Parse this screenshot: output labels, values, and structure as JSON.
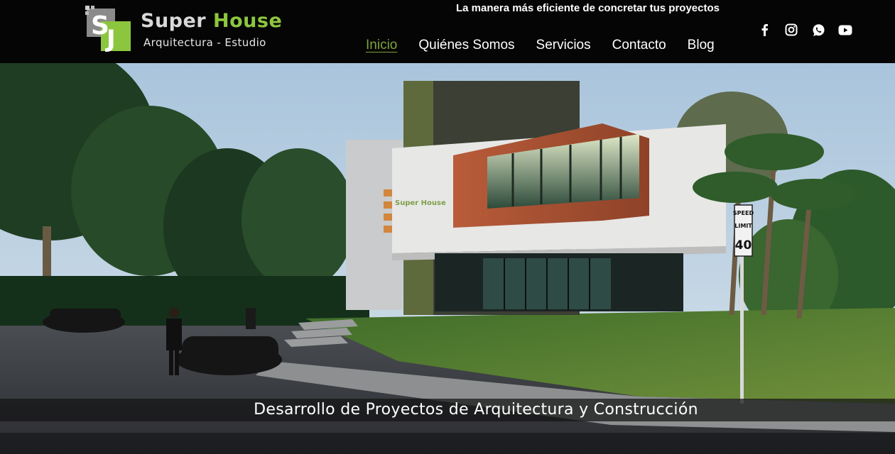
{
  "header": {
    "logo": {
      "name_word1": "Super",
      "name_word2": "House",
      "subtitle": "Arquitectura - Estudio",
      "mark_letters": "SH",
      "brand_green": "#8cc63f"
    },
    "tagline": "La manera más eficiente de concretar tus proyectos",
    "nav": [
      {
        "label": "Inicio",
        "active": true
      },
      {
        "label": "Quiénes Somos",
        "active": false
      },
      {
        "label": "Servicios",
        "active": false
      },
      {
        "label": "Contacto",
        "active": false
      },
      {
        "label": "Blog",
        "active": false
      }
    ],
    "nav_active_color": "#7ea33c",
    "social": [
      "facebook-icon",
      "instagram-icon",
      "whatsapp-icon",
      "youtube-icon"
    ]
  },
  "hero": {
    "caption": "Desarrollo de Proyectos de Arquitectura y Construcción",
    "facade_sign": "Super House",
    "speed_sign": {
      "top": "SPEED",
      "middle": "LIMIT",
      "value": "40"
    }
  }
}
